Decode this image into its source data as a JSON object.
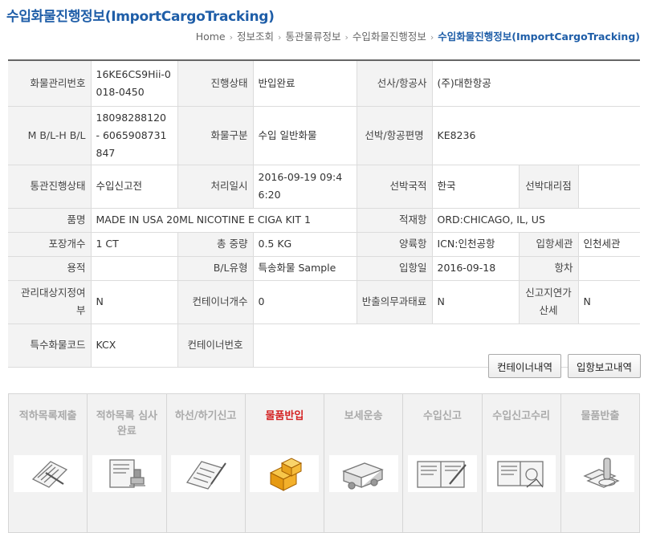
{
  "header": {
    "title": "수입화물진행정보(ImportCargoTracking)"
  },
  "breadcrumb": [
    "Home",
    "정보조회",
    "통관물류정보",
    "수입화물진행정보",
    "수입화물진행정보(ImportCargoTracking)"
  ],
  "table": {
    "cargo_no_label": "화물관리번호",
    "cargo_no": "16KE6CS9Hii-0018-0450",
    "progress_label": "진행상태",
    "progress": "반입완료",
    "carrier_label": "선사/항공사",
    "carrier": "(주)대한항공",
    "bl_label": "M B/L-H B/L",
    "bl": "18098288120 - 6065908731847",
    "cargo_type_label": "화물구분",
    "cargo_type": "수입 일반화물",
    "flight_label": "선박/항공편명",
    "flight": "KE8236",
    "customs_status_label": "통관진행상태",
    "customs_status": "수입신고전",
    "processed_at_label": "처리일시",
    "processed_at": "2016-09-19 09:46:20",
    "nationality_label": "선박국적",
    "nationality": "한국",
    "agent_label": "선박대리점",
    "agent": "",
    "item_label": "품명",
    "item": "MADE IN USA 20ML NICOTINE E CIGA KIT 1",
    "loading_port_label": "적재항",
    "loading_port": "ORD:CHICAGO, IL, US",
    "packages_label": "포장개수",
    "packages": "1 CT",
    "weight_label": "총 중량",
    "weight": "0.5 KG",
    "unloading_port_label": "양륙항",
    "unloading_port": "ICN:인천공항",
    "entry_customs_label": "입항세관",
    "entry_customs": "인천세관",
    "volume_label": "용적",
    "volume": "",
    "bl_type_label": "B/L유형",
    "bl_type": "특송화물 Sample",
    "entry_date_label": "입항일",
    "entry_date": "2016-09-18",
    "voyage_label": "항차",
    "voyage": "",
    "managed_label": "관리대상지정여부",
    "managed": "N",
    "container_count_label": "컨테이너개수",
    "container_count": "0",
    "export_duty_label": "반출의무과태료",
    "export_duty": "N",
    "late_tax_label": "신고지연가산세",
    "late_tax": "N",
    "special_code_label": "특수화물코드",
    "special_code": "KCX",
    "container_no_label": "컨테이너번호",
    "container_no": ""
  },
  "buttons": {
    "container_details": "컨테이너내역",
    "entry_report": "입항보고내역"
  },
  "steps": [
    {
      "label": "적하목록제출",
      "icon": "clipboard-icon",
      "active": false
    },
    {
      "label": "적하목록 심사완료",
      "icon": "stamp-icon",
      "active": false
    },
    {
      "label": "하선/하기신고",
      "icon": "document-pen-icon",
      "active": false
    },
    {
      "label": "물품반입",
      "icon": "boxes-icon",
      "active": true
    },
    {
      "label": "보세운송",
      "icon": "truck-icon",
      "active": false
    },
    {
      "label": "수입신고",
      "icon": "signing-icon",
      "active": false
    },
    {
      "label": "수입신고수리",
      "icon": "approval-icon",
      "active": false
    },
    {
      "label": "물품반출",
      "icon": "release-icon",
      "active": false
    }
  ]
}
